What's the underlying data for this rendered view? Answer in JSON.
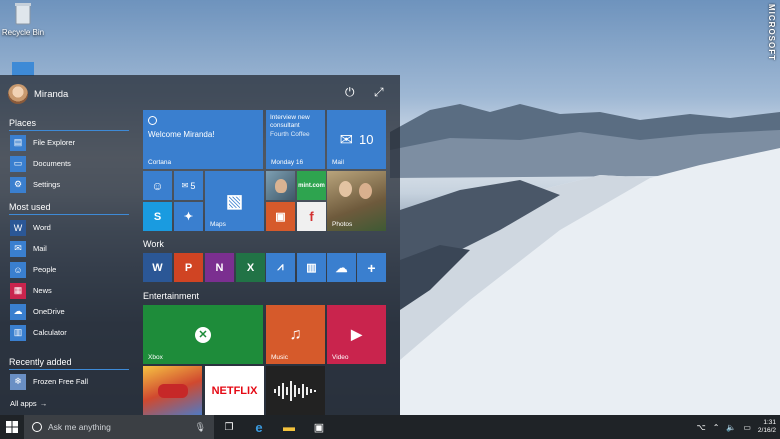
{
  "desktop": {
    "recycle_bin_label": "Recycle Bin",
    "watermark": "MICROSOFT"
  },
  "start_menu": {
    "user_name": "Miranda",
    "power_icon": "power-icon",
    "expand_icon": "expand-icon",
    "places": {
      "title": "Places",
      "items": [
        "File Explorer",
        "Documents",
        "Settings"
      ]
    },
    "most_used": {
      "title": "Most used",
      "items": [
        "Word",
        "Mail",
        "People",
        "News",
        "OneDrive",
        "Calculator"
      ]
    },
    "recently_added": {
      "title": "Recently added",
      "items": [
        "Frozen Free Fall"
      ]
    },
    "all_apps": "All apps",
    "tiles": {
      "cortana": {
        "greeting": "Welcome Miranda!",
        "label": "Cortana"
      },
      "calendar": {
        "line1": "Interview new",
        "line2": "consultant",
        "line3": "Fourth Coffee",
        "date": "Monday 16"
      },
      "mail": {
        "count": "10",
        "label": "Mail"
      },
      "people_count": "5",
      "maps_label": "Maps",
      "photos_label": "Photos",
      "mint_label": "mint.com",
      "work_title": "Work",
      "entertainment_title": "Entertainment",
      "xbox_label": "Xbox",
      "music_label": "Music",
      "video_label": "Video",
      "netflix_label": "NETFLIX"
    }
  },
  "taskbar": {
    "search_placeholder": "Ask me anything",
    "time": "1:31",
    "date": "2/16/2"
  },
  "colors": {
    "tile_blue": "#3a7fcf",
    "tile_green": "#1e8c3a",
    "tile_orange": "#d65a2b",
    "tile_red": "#c9244d",
    "word_blue": "#2b5796",
    "excel_green": "#217346",
    "onenote_purple": "#7b2f90",
    "powerpoint_orange": "#d04423"
  }
}
